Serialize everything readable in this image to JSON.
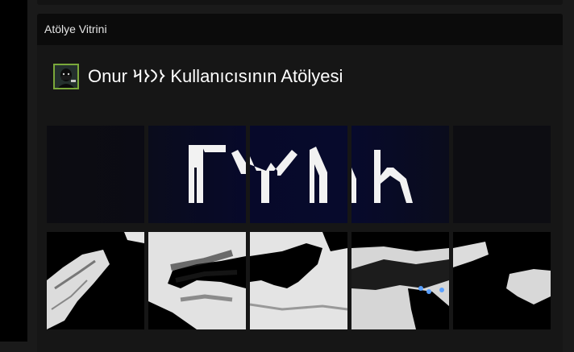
{
  "showcase": {
    "header_title": "Atölye Vitrini"
  },
  "workshop": {
    "title": "Onur 𐰆𐰣𐰆𐰺 Kullanıcısının Atölyesi"
  },
  "colors": {
    "background": "#1a1a1a",
    "rail": "#000000",
    "header": "#0b0b0b",
    "avatar_border": "#7aa83a",
    "banner_dark": "#050a26",
    "banner_edge": "#0d0d12",
    "title_text": "#ffffff"
  },
  "icons": {
    "avatar": "masked-person-avatar-icon"
  }
}
